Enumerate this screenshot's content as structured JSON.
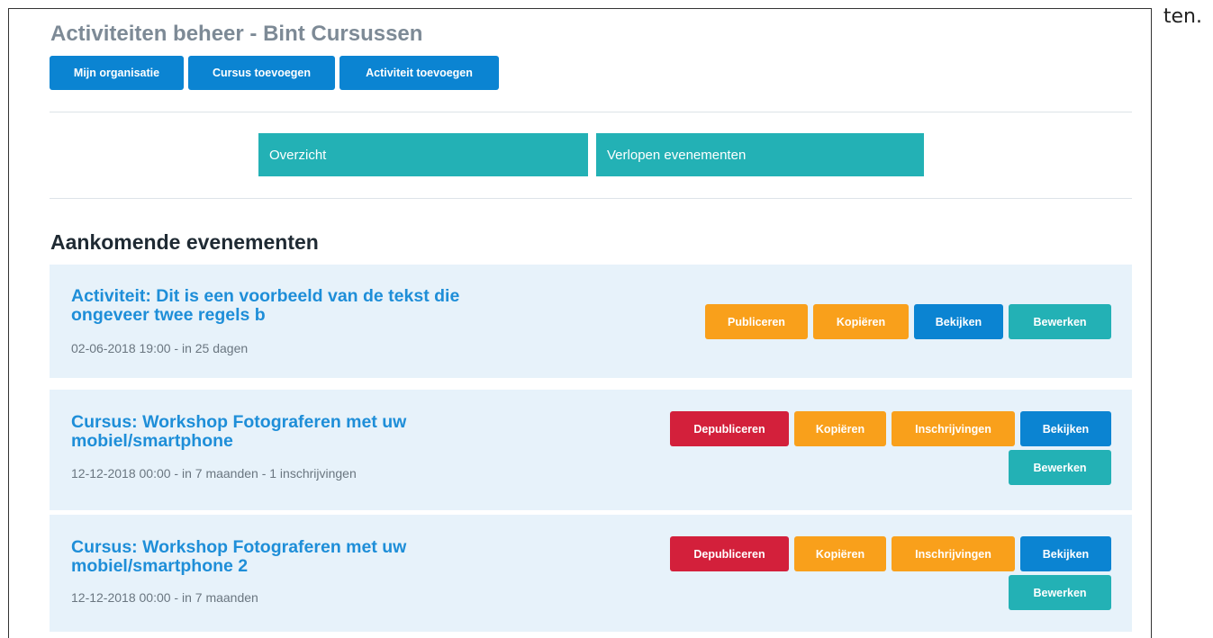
{
  "stray_text": "ten.",
  "header": {
    "title": "Activiteiten beheer - Bint Cursussen",
    "buttons": [
      "Mijn organisatie",
      "Cursus toevoegen",
      "Activiteit toevoegen"
    ]
  },
  "tabs": [
    "Overzicht",
    "Verlopen evenementen"
  ],
  "section_title": "Aankomende evenementen",
  "events": [
    {
      "title": "Activiteit: Dit is een voorbeeld van de tekst die ongeveer twee regels b",
      "meta": "02-06-2018 19:00 - in 25 dagen",
      "actions": [
        "Publiceren",
        "Kopiëren",
        "Bekijken",
        "Bewerken"
      ]
    },
    {
      "title": "Cursus: Workshop Fotograferen met uw mobiel/smartphone",
      "meta": "12-12-2018 00:00 - in 7 maanden - 1 inschrijvingen",
      "actions": [
        "Depubliceren",
        "Kopiëren",
        "Inschrijvingen",
        "Bekijken",
        "Bewerken"
      ]
    },
    {
      "title": "Cursus: Workshop Fotograferen met uw mobiel/smartphone 2",
      "meta": "12-12-2018 00:00 - in 7 maanden",
      "actions": [
        "Depubliceren",
        "Kopiëren",
        "Inschrijvingen",
        "Bekijken",
        "Bewerken"
      ]
    }
  ],
  "colors": {
    "blue": "#0b84d2",
    "orange": "#f9a01b",
    "red": "#d3203b",
    "teal": "#23b1b5",
    "card_bg": "#e7f2fa",
    "event_title": "#1e8ed8"
  }
}
